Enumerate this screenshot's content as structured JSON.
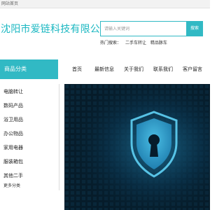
{
  "topbar": {
    "home_link": "网站首页"
  },
  "header": {
    "site_title": "沈阳市爱链科技有限公司",
    "search": {
      "placeholder": "请输入关键词",
      "button_label": "搜索"
    },
    "hot_search": {
      "label": "热门搜索：",
      "items": [
        "二手车转让",
        "精品豚车"
      ]
    }
  },
  "sidebar": {
    "header_label": "商品分类",
    "items": [
      "电脑转让",
      "数码产品",
      "浴卫用品",
      "办公物品",
      "家用电器",
      "服装箱包",
      "其他二手"
    ],
    "more_label": "更多分类"
  },
  "nav": {
    "items": [
      "首页",
      "最新信息",
      "关于我们",
      "联系我们",
      "客户留言"
    ]
  },
  "hero": {
    "image": "cyber-security-shield-banner"
  },
  "colors": {
    "accent": "#31b9c4",
    "title": "#1cb8c2",
    "hero_bg": "#061c2a"
  }
}
